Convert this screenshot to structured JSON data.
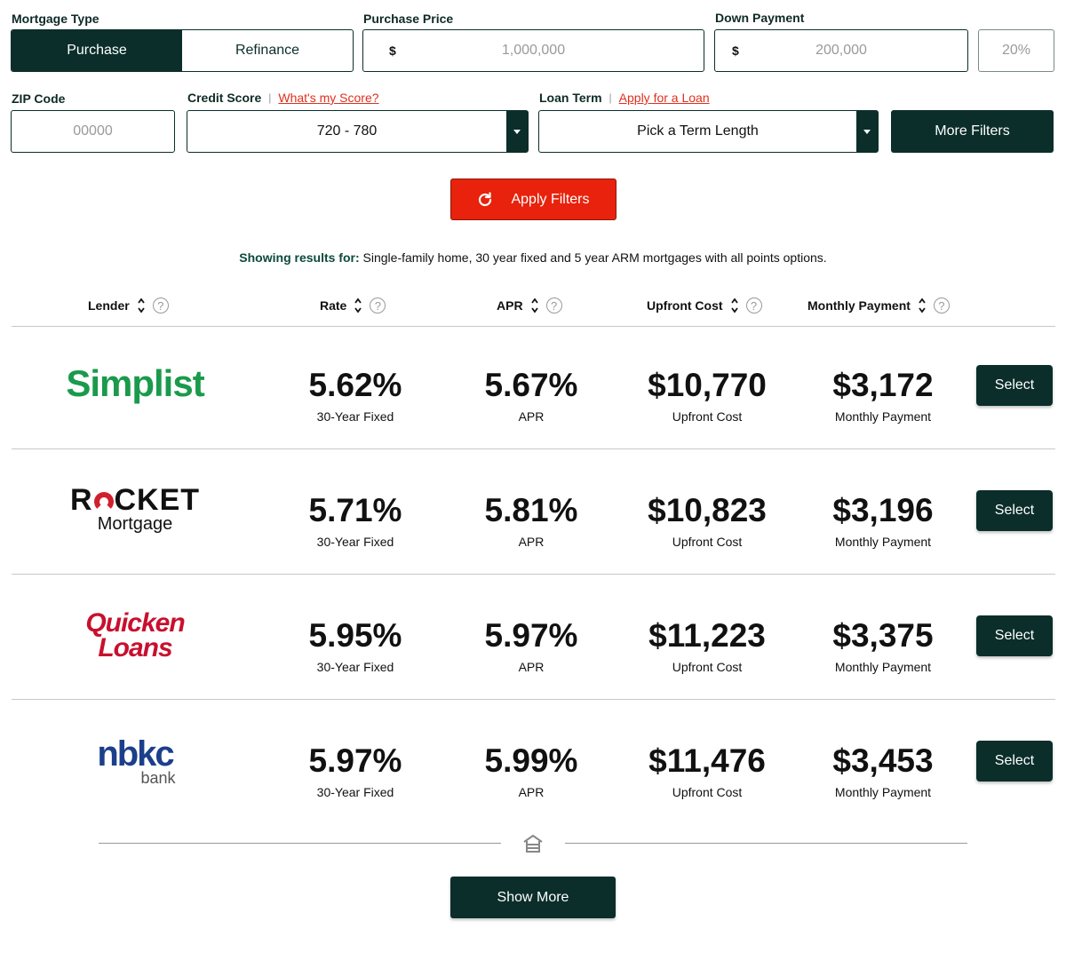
{
  "filters": {
    "mortgage_type_label": "Mortgage Type",
    "mortgage_type_options": [
      "Purchase",
      "Refinance"
    ],
    "mortgage_type_selected": "Purchase",
    "purchase_price_label": "Purchase Price",
    "purchase_price_currency": "$",
    "purchase_price_placeholder": "1,000,000",
    "down_payment_label": "Down Payment",
    "down_payment_currency": "$",
    "down_payment_placeholder": "200,000",
    "down_payment_percent_placeholder": "20%",
    "zip_label": "ZIP Code",
    "zip_placeholder": "00000",
    "credit_score_label": "Credit Score",
    "credit_score_link": "What's my Score?",
    "credit_score_value": "720 - 780",
    "loan_term_label": "Loan Term",
    "loan_term_link": "Apply for a Loan",
    "loan_term_value": "Pick a Term Length",
    "more_filters": "More Filters",
    "apply_filters": "Apply Filters"
  },
  "results_summary": {
    "prefix": "Showing results for:",
    "text": "Single-family home, 30 year fixed and 5 year ARM mortgages with all points options."
  },
  "table": {
    "headers": [
      "Lender",
      "Rate",
      "APR",
      "Upfront Cost",
      "Monthly Payment"
    ],
    "rows": [
      {
        "lender": "Simplist",
        "rate": "5.62%",
        "rate_sub": "30-Year Fixed",
        "apr": "5.67%",
        "apr_sub": "APR",
        "upfront": "$10,770",
        "upfront_sub": "Upfront Cost",
        "monthly": "$3,172",
        "monthly_sub": "Monthly Payment",
        "select": "Select"
      },
      {
        "lender": "Rocket Mortgage",
        "rate": "5.71%",
        "rate_sub": "30-Year Fixed",
        "apr": "5.81%",
        "apr_sub": "APR",
        "upfront": "$10,823",
        "upfront_sub": "Upfront Cost",
        "monthly": "$3,196",
        "monthly_sub": "Monthly Payment",
        "select": "Select"
      },
      {
        "lender": "Quicken Loans",
        "rate": "5.95%",
        "rate_sub": "30-Year Fixed",
        "apr": "5.97%",
        "apr_sub": "APR",
        "upfront": "$11,223",
        "upfront_sub": "Upfront Cost",
        "monthly": "$3,375",
        "monthly_sub": "Monthly Payment",
        "select": "Select"
      },
      {
        "lender": "nbkc bank",
        "rate": "5.97%",
        "rate_sub": "30-Year Fixed",
        "apr": "5.99%",
        "apr_sub": "APR",
        "upfront": "$11,476",
        "upfront_sub": "Upfront Cost",
        "monthly": "$3,453",
        "monthly_sub": "Monthly Payment",
        "select": "Select"
      }
    ]
  },
  "logos": {
    "simplist": "Simplist",
    "rocket_top_r": "R",
    "rocket_top_rest": "CKET",
    "rocket_bottom": "Mortgage",
    "quicken_line1": "Quicken",
    "quicken_line2": "Loans",
    "nbkc_top": "nbkc",
    "nbkc_bottom": "bank"
  },
  "show_more": "Show More",
  "colors": {
    "brand_dark": "#0b2e2a",
    "accent_red": "#e8220c",
    "simplist_green": "#1a9a4c",
    "quicken_red": "#c8102e",
    "nbkc_blue": "#1c3f8c"
  },
  "icons": [
    "refresh-icon",
    "sort-icon",
    "help-icon",
    "house-icon",
    "dropdown-arrow-icon"
  ]
}
